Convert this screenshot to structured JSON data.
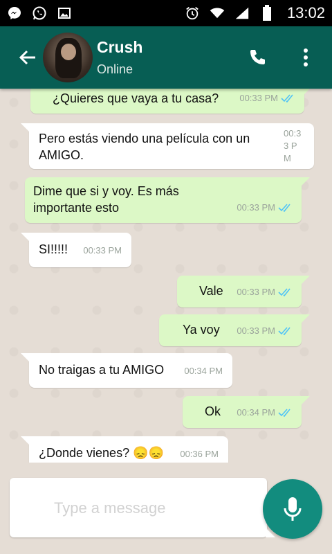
{
  "status_bar": {
    "time": "13:02",
    "icons": [
      "messenger-icon",
      "whatsapp-icon",
      "image-icon",
      "alarm-icon",
      "wifi-icon",
      "signal-icon",
      "battery-icon"
    ]
  },
  "header": {
    "contact_name": "Crush",
    "status": "Online",
    "accent_color": "#075e54"
  },
  "messages": [
    {
      "direction": "out",
      "text": "¿Quieres que vaya a tu casa?",
      "time": "00:33 PM",
      "read": true
    },
    {
      "direction": "in",
      "text": "Pero estás viendo una película con un AMIGO.",
      "time": "00:33 PM"
    },
    {
      "direction": "out",
      "text": "Dime que si y voy. Es más importante esto",
      "time": "00:33 PM",
      "read": true
    },
    {
      "direction": "in",
      "text": "SI!!!!!",
      "time": "00:33 PM"
    },
    {
      "direction": "out",
      "text": "Vale",
      "time": "00:33 PM",
      "read": true
    },
    {
      "direction": "out",
      "text": "Ya voy",
      "time": "00:33 PM",
      "read": true
    },
    {
      "direction": "in",
      "text": "No traigas a tu AMIGO",
      "time": "00:34 PM"
    },
    {
      "direction": "out",
      "text": "Ok",
      "time": "00:34 PM",
      "read": true
    },
    {
      "direction": "in",
      "text": "¿Donde vienes? 😞😞",
      "time": "00:36 PM"
    }
  ],
  "composer": {
    "placeholder": "Type a message"
  }
}
